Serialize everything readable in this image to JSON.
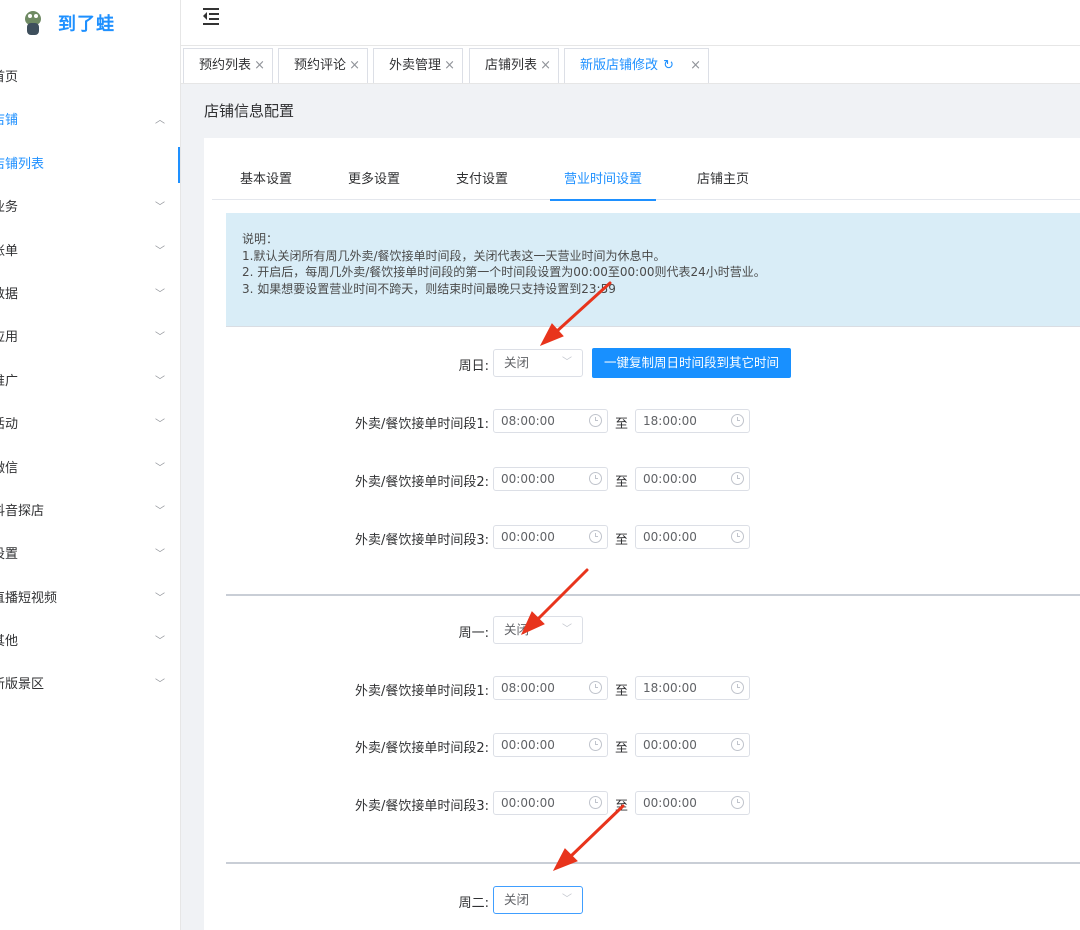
{
  "app": {
    "name": "到了蛙"
  },
  "sidebar": {
    "items": [
      {
        "label": "首页"
      },
      {
        "label": "店铺"
      },
      {
        "label": "店铺列表"
      },
      {
        "label": "业务"
      },
      {
        "label": "账单"
      },
      {
        "label": "数据"
      },
      {
        "label": "应用"
      },
      {
        "label": "推广"
      },
      {
        "label": "活动"
      },
      {
        "label": "微信"
      },
      {
        "label": "抖音探店"
      },
      {
        "label": "设置"
      },
      {
        "label": "直播短视频"
      },
      {
        "label": "其他"
      },
      {
        "label": "新版景区"
      }
    ]
  },
  "tabs": [
    {
      "label": "预约列表"
    },
    {
      "label": "预约评论"
    },
    {
      "label": "外卖管理"
    },
    {
      "label": "店铺列表"
    },
    {
      "label": "新版店铺修改"
    }
  ],
  "page": {
    "title": "店铺信息配置"
  },
  "inner_tabs": [
    {
      "label": "基本设置"
    },
    {
      "label": "更多设置"
    },
    {
      "label": "支付设置"
    },
    {
      "label": "营业时间设置"
    },
    {
      "label": "店铺主页"
    }
  ],
  "notice": {
    "title": "说明：",
    "lines": [
      "1.默认关闭所有周几外卖/餐饮接单时间段，关闭代表这一天营业时间为休息中。",
      "2. 开启后，每周几外卖/餐饮接单时间段的第一个时间段设置为00:00至00:00则代表24小时营业。",
      "3. 如果想要设置营业时间不跨天，则结束时间最晚只支持设置到23:59"
    ]
  },
  "copy_button": "一键复制周日时间段到其它时间",
  "range_separator": "至",
  "days": [
    {
      "label": "周日:",
      "status": "关闭",
      "slots": [
        {
          "label": "外卖/餐饮接单时间段1:",
          "start": "08:00:00",
          "end": "18:00:00"
        },
        {
          "label": "外卖/餐饮接单时间段2:",
          "start": "00:00:00",
          "end": "00:00:00"
        },
        {
          "label": "外卖/餐饮接单时间段3:",
          "start": "00:00:00",
          "end": "00:00:00"
        }
      ]
    },
    {
      "label": "周一:",
      "status": "关闭",
      "slots": [
        {
          "label": "外卖/餐饮接单时间段1:",
          "start": "08:00:00",
          "end": "18:00:00"
        },
        {
          "label": "外卖/餐饮接单时间段2:",
          "start": "00:00:00",
          "end": "00:00:00"
        },
        {
          "label": "外卖/餐饮接单时间段3:",
          "start": "00:00:00",
          "end": "00:00:00"
        }
      ]
    },
    {
      "label": "周二:",
      "status": "关闭"
    }
  ],
  "colors": {
    "accent": "#1e90ff",
    "button": "#1890ff",
    "notice_bg": "#d9edf7",
    "annotation": "#e8341c"
  }
}
